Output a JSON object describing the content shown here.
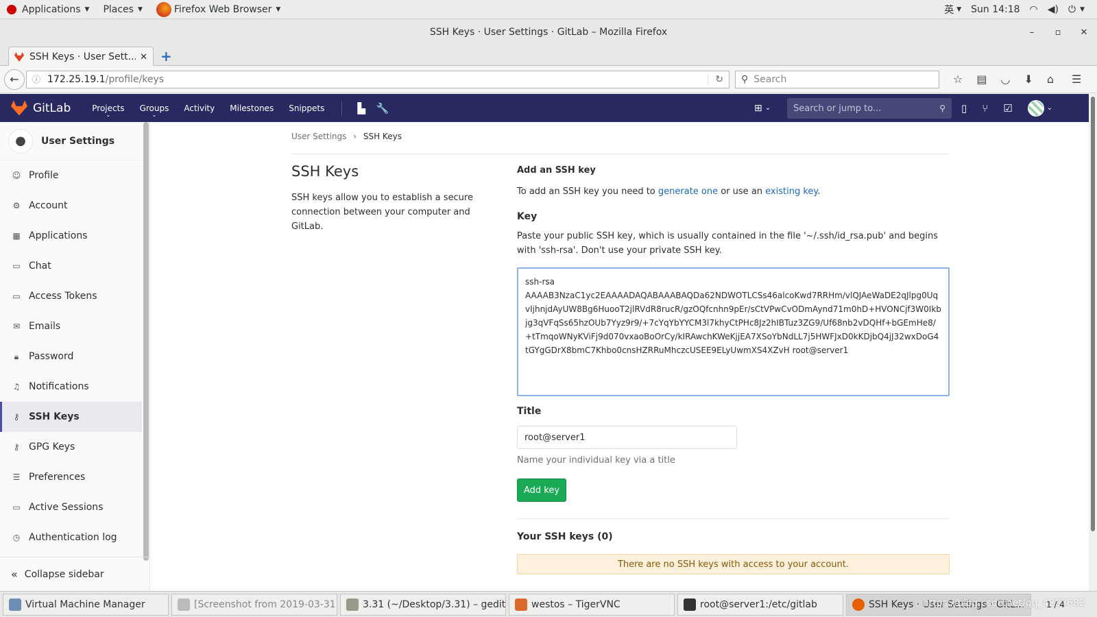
{
  "system": {
    "applications": "Applications",
    "places": "Places",
    "active_app": "Firefox Web Browser",
    "lang": "英",
    "clock": "Sun 14:18"
  },
  "window": {
    "title": "SSH Keys · User Settings · GitLab – Mozilla Firefox",
    "tab_label": "SSH Keys · User Sett..."
  },
  "navbar": {
    "url_host": "172.25.19.1",
    "url_path": "/profile/keys",
    "search_placeholder": "Search"
  },
  "gitlab_header": {
    "brand": "GitLab",
    "nav": [
      "Projects",
      "Groups",
      "Activity",
      "Milestones",
      "Snippets"
    ],
    "search_placeholder": "Search or jump to..."
  },
  "sidebar": {
    "title": "User Settings",
    "items": [
      {
        "label": "Profile",
        "icon": "profile-icon"
      },
      {
        "label": "Account",
        "icon": "account-icon"
      },
      {
        "label": "Applications",
        "icon": "applications-icon"
      },
      {
        "label": "Chat",
        "icon": "chat-icon"
      },
      {
        "label": "Access Tokens",
        "icon": "token-icon"
      },
      {
        "label": "Emails",
        "icon": "email-icon"
      },
      {
        "label": "Password",
        "icon": "lock-icon"
      },
      {
        "label": "Notifications",
        "icon": "bell-icon"
      },
      {
        "label": "SSH Keys",
        "icon": "key-icon"
      },
      {
        "label": "GPG Keys",
        "icon": "key-icon"
      },
      {
        "label": "Preferences",
        "icon": "sliders-icon"
      },
      {
        "label": "Active Sessions",
        "icon": "monitor-icon"
      },
      {
        "label": "Authentication log",
        "icon": "history-icon"
      }
    ],
    "collapse": "Collapse sidebar"
  },
  "breadcrumb": {
    "parent": "User Settings",
    "current": "SSH Keys"
  },
  "page": {
    "heading": "SSH Keys",
    "description": "SSH keys allow you to establish a secure connection between your computer and GitLab.",
    "add_heading": "Add an SSH key",
    "add_text_1": "To add an SSH key you need to ",
    "add_link_1": "generate one",
    "add_text_2": " or use an ",
    "add_link_2": "existing key",
    "add_text_3": ".",
    "key_label": "Key",
    "key_help": "Paste your public SSH key, which is usually contained in the file '~/.ssh/id_rsa.pub' and begins with 'ssh-rsa'. Don't use your private SSH key.",
    "key_value": "ssh-rsa\nAAAAB3NzaC1yc2EAAAADAQABAAABAQDa62NDWOTLCSs46alcoKwd7RRHm/vlQJAeWaDE2qJlpg0UqvIjhnjdAyUW8Bg6HuooT2jlRVdR8rucR/gzOQfcnhn9pEr/sCtVPwCvODmAynd71m0hD+HVONCjf3W0Ikbjg3qVFqSs65hzOUb7Yyz9r9/+7cYqYbYYCM3l7khyCtPHc8Jz2hIBTuz3ZG9/Uf68nb2vDQHf+bGEmHe8/+tTmqoWNyKViFj9d070vxaoBoOrCy/kIRAwchKWeKjjEA7XSoYbNdLL7j5HWFJxD0kKDjbQ4jJ32wxDoG4tGYgGDrX8bmC7Khbo0cnsHZRRuMhczcUSEE9ELyUwmXS4XZvH root@server1",
    "title_label": "Title",
    "title_value": "root@server1",
    "title_help": "Name your individual key via a title",
    "add_button": "Add key",
    "your_keys": "Your SSH keys (0)",
    "empty_notice": "There are no SSH keys with access to your account."
  },
  "taskbar": {
    "items": [
      "Virtual Machine Manager",
      "[Screenshot from 2019-03-31...",
      "3.31 (~/Desktop/3.31) – gedit",
      "westos – TigerVNC",
      "root@server1:/etc/gitlab",
      "SSH Keys · User Settings · GitL..."
    ],
    "pager": "1 / 4",
    "watermark": "https://blog.csdn.net/qq_4203682"
  }
}
